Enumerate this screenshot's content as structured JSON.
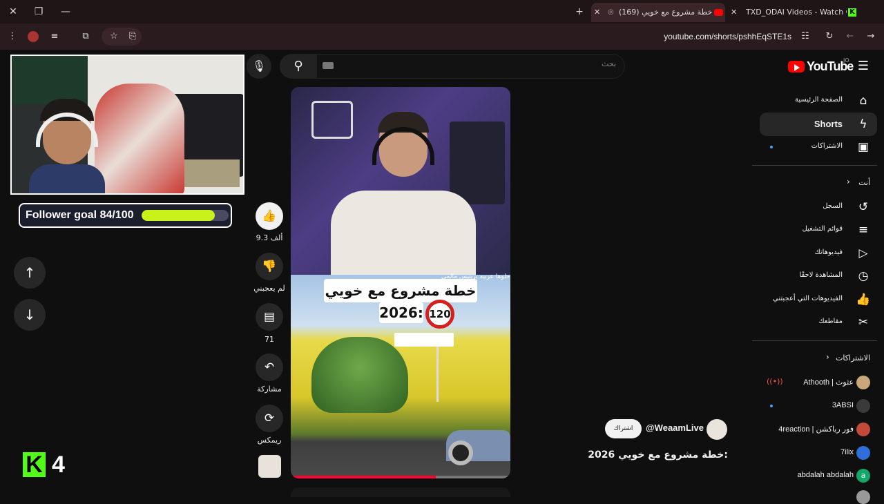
{
  "browser": {
    "tabs": [
      {
        "title": "(169) خطة مشروع مع خويي",
        "active": true
      },
      {
        "title": "TXD_ODAI Videos - Watch On-D",
        "active": false
      }
    ],
    "url": "youtube.com/shorts/pshhEqSTE1s"
  },
  "overlay": {
    "follower_goal_label": "Follower goal 84/100",
    "follower_goal_current": 84,
    "follower_goal_total": 100,
    "kick_count": "4",
    "kick_logo_letter": "K"
  },
  "search": {
    "placeholder": "بحث"
  },
  "video": {
    "banner_title": "خطة مشروع مع خويي",
    "banner_year": "2026:",
    "speed_sign": "120",
    "subtitle": "يه حلوها عربيه بريتيس مالمي",
    "progress": 0.66
  },
  "actions": {
    "like_count": "9.3 ألف",
    "dislike_label": "لم يعجبني",
    "comment_count": "71",
    "share_label": "مشاركة",
    "remix_label": "ريمكس"
  },
  "channel": {
    "handle": "@WeaamLive",
    "subscribe_label": "اشتراك",
    "video_title": "خطة مشروع مع خويي 2026:"
  },
  "sidebar": {
    "logo_text": "YouTube",
    "country_code": "JO",
    "main": [
      {
        "label": "الصفحة الرئيسية",
        "icon": "home-icon"
      },
      {
        "label": "Shorts",
        "icon": "shorts-icon",
        "active": true
      },
      {
        "label": "الاشتراكات",
        "icon": "subscriptions-icon"
      }
    ],
    "you_title": "أنت",
    "you": [
      {
        "label": "السجل",
        "icon": "history-icon"
      },
      {
        "label": "قوائم التشغيل",
        "icon": "playlists-icon"
      },
      {
        "label": "فيديوهاتك",
        "icon": "your-videos-icon"
      },
      {
        "label": "المشاهدة لاحقًا",
        "icon": "watch-later-icon"
      },
      {
        "label": "الفيديوهات التي أعجبتني",
        "icon": "liked-videos-icon"
      },
      {
        "label": "مقاطعك",
        "icon": "clips-icon"
      }
    ],
    "subs_title": "الاشتراكات",
    "subscriptions": [
      {
        "name": "Athooth | عثوث",
        "color": "#c9a77a",
        "live": true
      },
      {
        "name": "3ABSI",
        "color": "#3a3a3a",
        "new": true
      },
      {
        "name": "4reaction | فور رياكشن",
        "color": "#c24a3a"
      },
      {
        "name": "7ilix",
        "color": "#2f6fd9"
      },
      {
        "name": "abdalah abdalah",
        "color": "#13a86a",
        "avatar_letter": "a"
      }
    ]
  }
}
